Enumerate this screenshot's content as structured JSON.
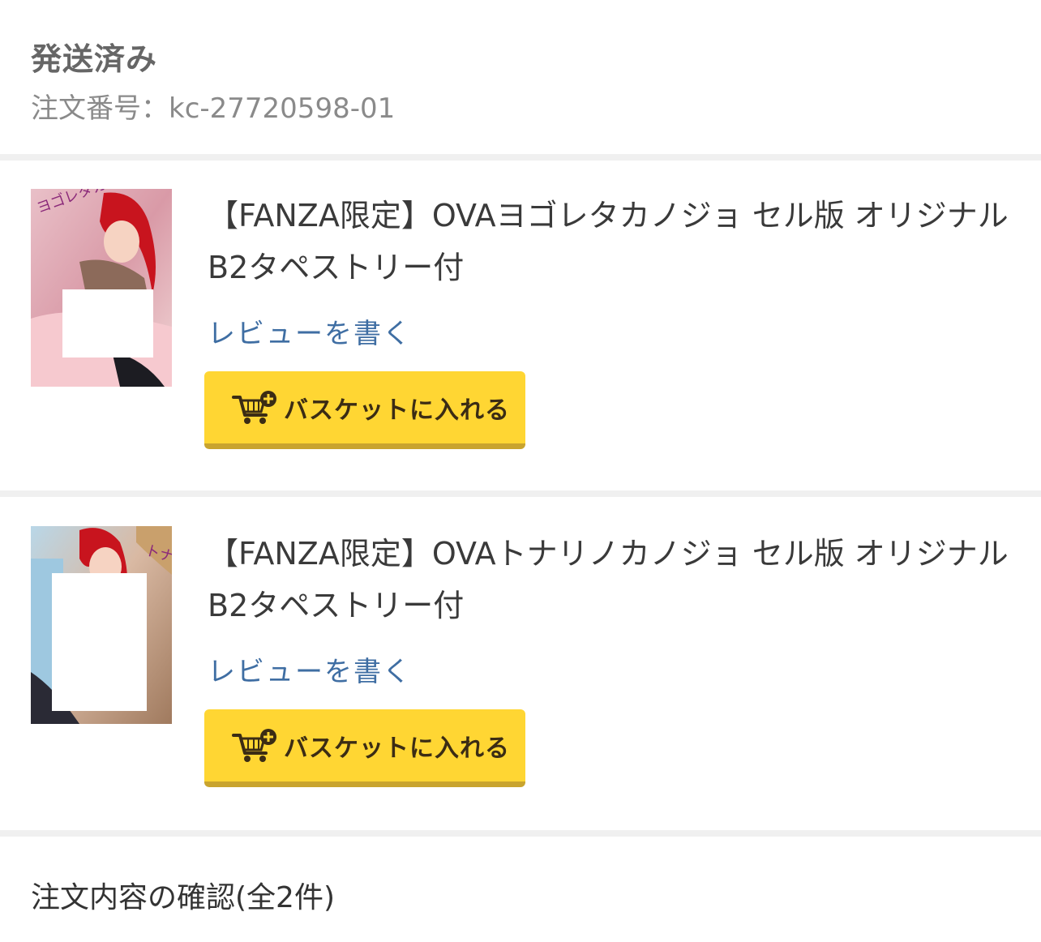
{
  "order": {
    "status": "発送済み",
    "order_number": "注文番号：kc-27720598-01"
  },
  "items": [
    {
      "title": "【FANZA限定】OVAヨゴレタカノジョ セル版 オリジナルB2タペストリー付",
      "review_label": "レビューを書く",
      "basket_label": "バスケットに入れる",
      "cover_text": "ヨゴレタカノジョ"
    },
    {
      "title": "【FANZA限定】OVAトナリノカノジョ セル版 オリジナルB2タペストリー付",
      "review_label": "レビューを書く",
      "basket_label": "バスケットに入れる",
      "cover_text": "トナリノカノジョ"
    }
  ],
  "footer": {
    "summary": "注文内容の確認(全2件)"
  },
  "colors": {
    "button_bg": "#ffd633",
    "button_shadow": "#c9a42e",
    "link": "#3f6ea3"
  },
  "icons": {
    "cart": "cart-plus-icon"
  }
}
